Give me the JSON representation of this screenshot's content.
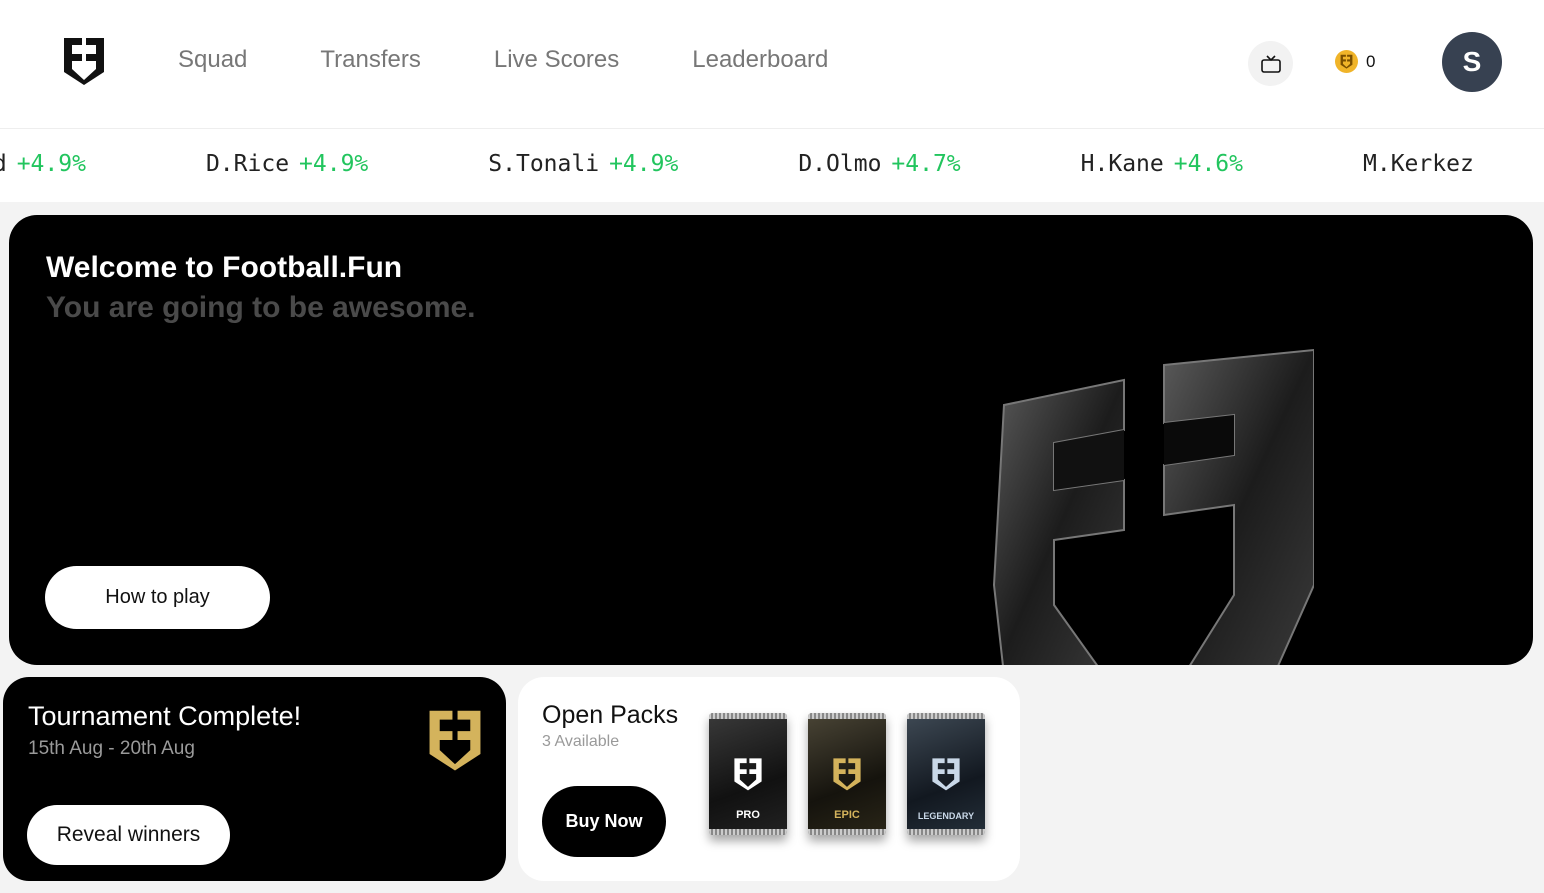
{
  "header": {
    "nav": [
      {
        "label": "Squad"
      },
      {
        "label": "Transfers"
      },
      {
        "label": "Live Scores"
      },
      {
        "label": "Leaderboard"
      }
    ],
    "coins": "0",
    "avatar_initial": "S"
  },
  "ticker": [
    {
      "name": "od",
      "change": "+4.9%"
    },
    {
      "name": "D.Rice",
      "change": "+4.9%"
    },
    {
      "name": "S.Tonali",
      "change": "+4.9%"
    },
    {
      "name": "D.Olmo",
      "change": "+4.7%"
    },
    {
      "name": "H.Kane",
      "change": "+4.6%"
    },
    {
      "name": "M.Kerkez",
      "change": ""
    }
  ],
  "hero": {
    "title": "Welcome to Football.Fun",
    "subtitle": "You are going to be awesome.",
    "button": "How to play"
  },
  "tournament": {
    "title": "Tournament Complete!",
    "dates": "15th Aug - 20th Aug",
    "button": "Reveal winners"
  },
  "packs": {
    "title": "Open Packs",
    "available": "3 Available",
    "button": "Buy Now",
    "items": [
      {
        "label": "PRO",
        "color": "#ffffff"
      },
      {
        "label": "EPIC",
        "color": "#d4b35c"
      },
      {
        "label": "LEGENDARY",
        "color": "#c9d8e8"
      }
    ]
  },
  "colors": {
    "accent_gold": "#d4b35c",
    "positive": "#22c55e",
    "avatar_bg": "#374151"
  }
}
